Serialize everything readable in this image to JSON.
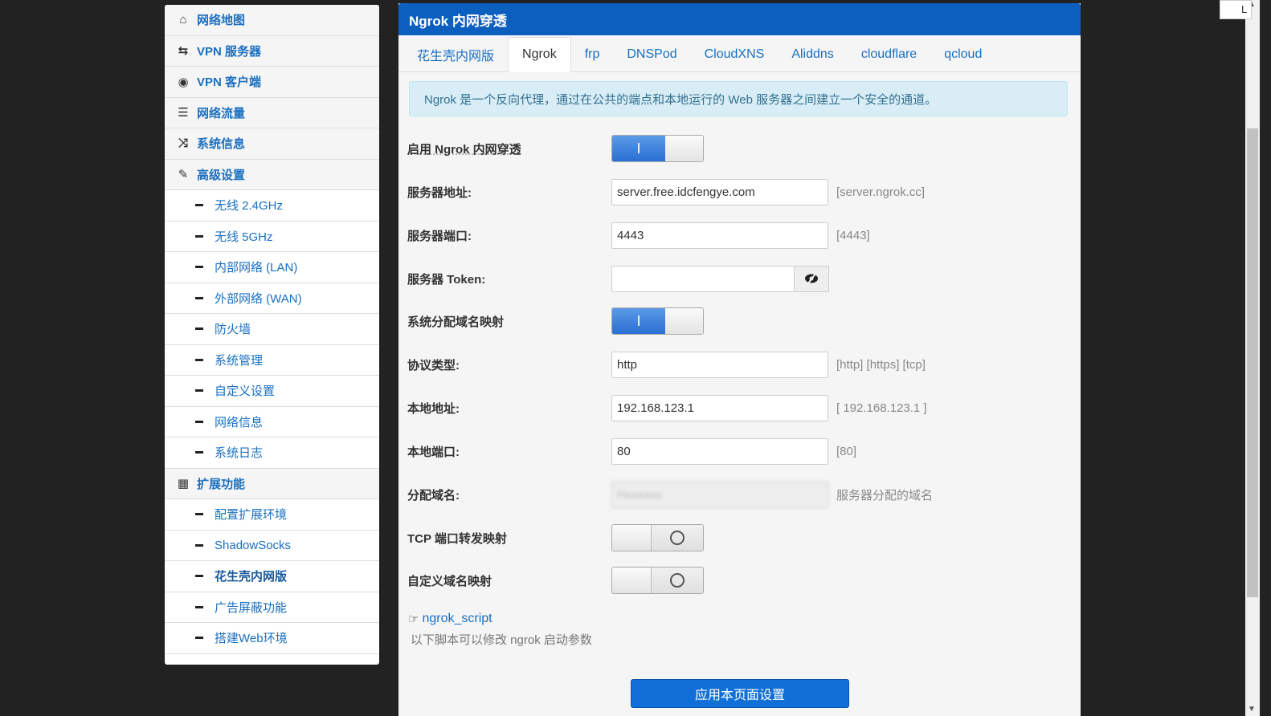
{
  "sidebar": {
    "items": [
      {
        "type": "top",
        "icon": "home-icon",
        "glyph": "⌂",
        "label": "网络地图"
      },
      {
        "type": "top",
        "icon": "retweet-icon",
        "glyph": "⇆",
        "label": "VPN 服务器"
      },
      {
        "type": "top",
        "icon": "globe-icon",
        "glyph": "◉",
        "label": "VPN 客户端"
      },
      {
        "type": "top",
        "icon": "server-icon",
        "glyph": "☰",
        "label": "网络流量"
      },
      {
        "type": "top",
        "icon": "random-icon",
        "glyph": "⤨",
        "label": "系统信息"
      },
      {
        "type": "top",
        "icon": "wrench-icon",
        "glyph": "✎",
        "label": "高级设置"
      },
      {
        "type": "sub",
        "label": "无线 2.4GHz"
      },
      {
        "type": "sub",
        "label": "无线 5GHz"
      },
      {
        "type": "sub",
        "label": "内部网络 (LAN)"
      },
      {
        "type": "sub",
        "label": "外部网络 (WAN)"
      },
      {
        "type": "sub",
        "label": "防火墙"
      },
      {
        "type": "sub",
        "label": "系统管理"
      },
      {
        "type": "sub",
        "label": "自定义设置"
      },
      {
        "type": "sub",
        "label": "网络信息"
      },
      {
        "type": "sub",
        "label": "系统日志"
      },
      {
        "type": "top",
        "icon": "grid-icon",
        "glyph": "▦",
        "label": "扩展功能"
      },
      {
        "type": "sub",
        "label": "配置扩展环境"
      },
      {
        "type": "sub",
        "label": "ShadowSocks"
      },
      {
        "type": "sub",
        "label": "花生壳内网版",
        "active": true
      },
      {
        "type": "sub",
        "label": "广告屏蔽功能"
      },
      {
        "type": "sub",
        "label": "搭建Web环境"
      }
    ]
  },
  "panel": {
    "title": "Ngrok 内网穿透",
    "tabs": [
      "花生壳内网版",
      "Ngrok",
      "frp",
      "DNSPod",
      "CloudXNS",
      "Aliddns",
      "cloudflare",
      "qcloud"
    ],
    "active_tab": 1,
    "info": "Ngrok 是一个反向代理，通过在公共的端点和本地运行的 Web 服务器之间建立一个安全的通道。"
  },
  "form": {
    "enable_label": "启用 Ngrok 内网穿透",
    "server_addr_label": "服务器地址:",
    "server_addr_value": "server.free.idcfengye.com",
    "server_addr_hint": "[server.ngrok.cc]",
    "server_port_label": "服务器端口:",
    "server_port_value": "4443",
    "server_port_hint": "[4443]",
    "token_label": "服务器 Token:",
    "token_value": "",
    "auto_domain_label": "系统分配域名映射",
    "protocol_label": "协议类型:",
    "protocol_value": "http",
    "protocol_hint": "[http] [https] [tcp]",
    "local_addr_label": "本地地址:",
    "local_addr_value": "192.168.123.1",
    "local_addr_hint": "[ 192.168.123.1 ]",
    "local_port_label": "本地端口:",
    "local_port_value": "80",
    "local_port_hint": "[80]",
    "domain_label": "分配域名:",
    "domain_value": "Hxxxxxx",
    "domain_hint": "服务器分配的域名",
    "tcp_label": "TCP 端口转发映射",
    "custom_domain_label": "自定义域名映射",
    "script_link": "ngrok_script",
    "script_desc": "以下脚本可以修改 ngrok 启动参数",
    "toggle_on_glyph": "I",
    "apply_button": "应用本页面设置"
  },
  "corner_text": "L",
  "colors": {
    "brand": "#0d5fbf",
    "link": "#1a6fc0",
    "info_bg": "#d9edf7"
  }
}
